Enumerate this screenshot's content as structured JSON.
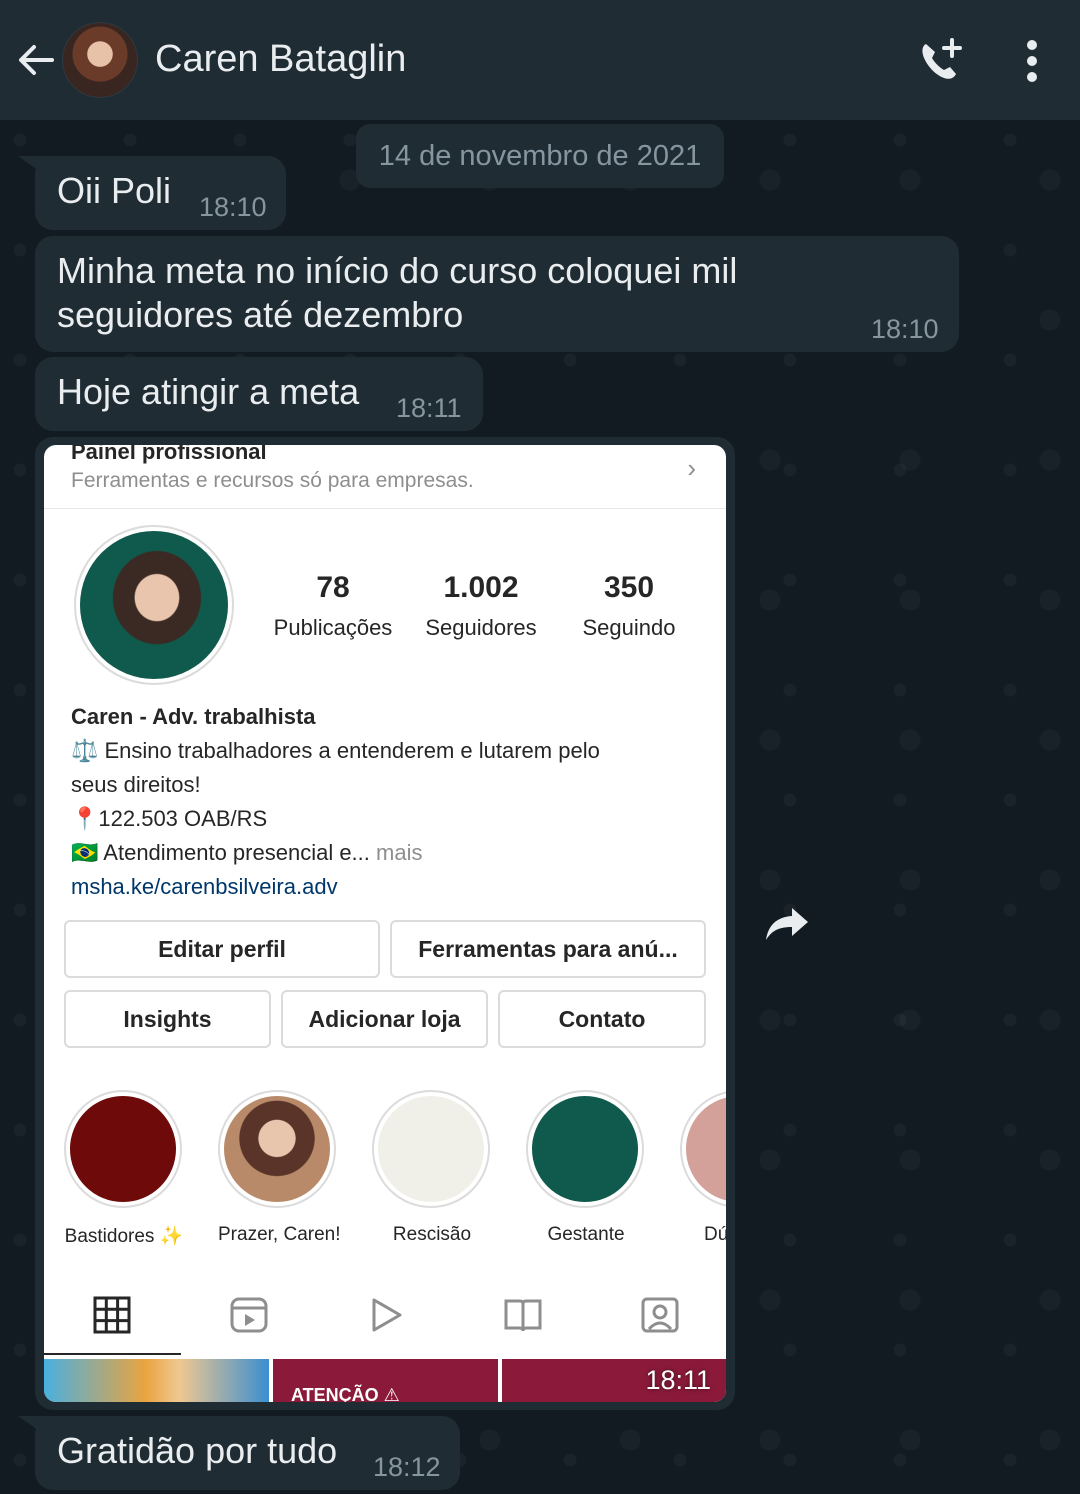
{
  "header": {
    "contact_name": "Caren Bataglin",
    "icons": [
      "arrow-left",
      "add-call",
      "more-vert"
    ]
  },
  "date_chip": "14 de novembro de 2021",
  "messages": [
    {
      "text": "Oii Poli",
      "time": "18:10"
    },
    {
      "text_line1": "Minha meta no início do curso coloquei mil",
      "text_line2": "seguidores  até dezembro",
      "time": "18:10"
    },
    {
      "text": "Hoje atingir a meta",
      "time": "18:11"
    },
    {
      "text": "Gratidão por tudo",
      "time": "18:12"
    }
  ],
  "image_message": {
    "time": "18:11",
    "instagram": {
      "pro_panel_title": "Painel profissional",
      "pro_panel_subtitle": "Ferramentas e recursos só para empresas.",
      "stats": [
        {
          "value": "78",
          "label": "Publicações"
        },
        {
          "value": "1.002",
          "label": "Seguidores"
        },
        {
          "value": "350",
          "label": "Seguindo"
        }
      ],
      "bio": {
        "name": "Caren - Adv. trabalhista",
        "line1": "⚖️ Ensino trabalhadores a entenderem e lutarem pelo",
        "line2": "seus direitos!",
        "line3": "📍122.503 OAB/RS",
        "line4": "🇧🇷 Atendimento presencial e...",
        "more": " mais",
        "link": "msha.ke/carenbsilveira.adv"
      },
      "buttons": {
        "edit_profile": "Editar perfil",
        "ad_tools": "Ferramentas para anú...",
        "insights": "Insights",
        "add_shop": "Adicionar loja",
        "contact": "Contato"
      },
      "highlights": [
        {
          "label": "Bastidores ✨",
          "color": "#6e0a0a"
        },
        {
          "label": "Prazer, Caren!",
          "color": "#c8a58a"
        },
        {
          "label": "Rescisão",
          "color": "#f1f0e8"
        },
        {
          "label": "Gestante",
          "color": "#0f5a4c"
        },
        {
          "label": "Dú",
          "color": "#d4a09a"
        }
      ],
      "tabs": [
        "grid-icon",
        "reels-icon",
        "video-icon",
        "guide-icon",
        "tagged-icon"
      ],
      "thumb_text": "ATENÇÃO ⚠"
    }
  }
}
